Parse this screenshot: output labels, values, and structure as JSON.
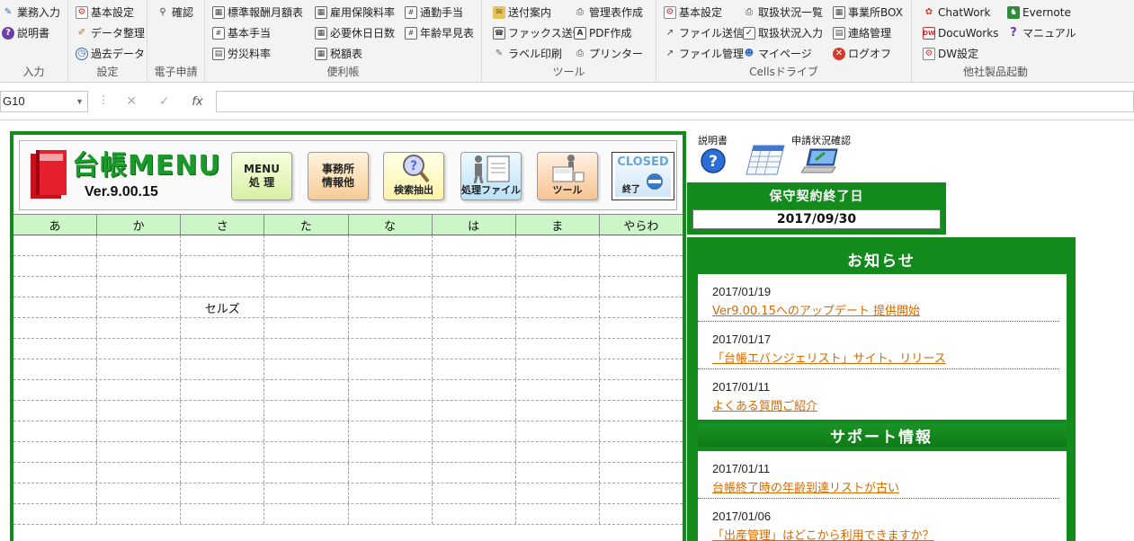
{
  "ribbon": {
    "groups": [
      {
        "label": "入力",
        "items": [
          {
            "label": "業務入力",
            "icon": "pencil-icon"
          },
          {
            "label": "説明書",
            "icon": "help-icon"
          }
        ]
      },
      {
        "label": "設定",
        "items": [
          {
            "label": "基本設定",
            "icon": "settings-icon"
          },
          {
            "label": "データ整理",
            "icon": "broom-icon"
          },
          {
            "label": "過去データ",
            "icon": "history-icon"
          }
        ]
      },
      {
        "label": "電子申請",
        "items": [
          {
            "label": "確認",
            "icon": "search-icon"
          }
        ]
      },
      {
        "label": "便利帳",
        "items": [
          {
            "label": "標準報酬月額表",
            "icon": "table-icon"
          },
          {
            "label": "基本手当",
            "icon": "calc-icon"
          },
          {
            "label": "労災料率",
            "icon": "list-icon"
          },
          {
            "label": "雇用保険料率",
            "icon": "table-icon"
          },
          {
            "label": "必要休日日数",
            "icon": "calendar-icon"
          },
          {
            "label": "税額表",
            "icon": "table-icon"
          },
          {
            "label": "通勤手当",
            "icon": "calc-icon"
          },
          {
            "label": "年齢早見表",
            "icon": "calc-icon"
          }
        ]
      },
      {
        "label": "ツール",
        "items": [
          {
            "label": "送付案内",
            "icon": "envelope-icon"
          },
          {
            "label": "ファックス送信",
            "icon": "fax-icon"
          },
          {
            "label": "ラベル印刷",
            "icon": "label-icon"
          },
          {
            "label": "管理表作成",
            "icon": "printer-icon"
          },
          {
            "label": "PDF作成",
            "icon": "pdf-icon"
          },
          {
            "label": "プリンター",
            "icon": "printer-icon"
          }
        ]
      },
      {
        "label": "Cellsドライブ",
        "items": [
          {
            "label": "基本設定",
            "icon": "settings-icon"
          },
          {
            "label": "ファイル送信",
            "icon": "upload-icon"
          },
          {
            "label": "ファイル管理",
            "icon": "folder-icon"
          },
          {
            "label": "取扱状況一覧",
            "icon": "printer-icon"
          },
          {
            "label": "取扱状況入力",
            "icon": "check-icon"
          },
          {
            "label": "マイページ",
            "icon": "users-icon"
          },
          {
            "label": "事業所BOX",
            "icon": "box-icon"
          },
          {
            "label": "連絡管理",
            "icon": "table-icon"
          },
          {
            "label": "ログオフ",
            "icon": "logoff-icon"
          }
        ]
      },
      {
        "label": "他社製品起動",
        "items": [
          {
            "label": "ChatWork",
            "icon": "chatwork-icon"
          },
          {
            "label": "DocuWorks",
            "icon": "docuworks-icon"
          },
          {
            "label": "DW設定",
            "icon": "settings-icon"
          },
          {
            "label": "Evernote",
            "icon": "evernote-icon"
          },
          {
            "label": "マニュアル",
            "icon": "question-icon"
          }
        ]
      }
    ]
  },
  "formula_bar": {
    "name_box": "G10",
    "cancel": "✕",
    "enter": "✓",
    "fx": "fx",
    "value": ""
  },
  "menu": {
    "app_title": "台帳MENU",
    "version": "Ver.9.00.15",
    "buttons": {
      "menu_line1": "MENU",
      "menu_line2": "処 理",
      "office_line1": "事務所",
      "office_line2": "情報他",
      "search": "検索抽出",
      "files": "処理ファイル",
      "tools": "ツール",
      "closed_word": "CLOSED",
      "closed_sub": "終了"
    },
    "kana": [
      "あ",
      "か",
      "さ",
      "た",
      "な",
      "は",
      "ま",
      "やらわ"
    ],
    "grid_rows": [
      [
        "",
        "",
        "",
        "",
        "",
        "",
        "",
        ""
      ],
      [
        "",
        "",
        "",
        "",
        "",
        "",
        "",
        ""
      ],
      [
        "",
        "",
        "",
        "",
        "",
        "",
        "",
        ""
      ],
      [
        "",
        "",
        "セルズ",
        "",
        "",
        "",
        "",
        ""
      ],
      [
        "",
        "",
        "",
        "",
        "",
        "",
        "",
        ""
      ],
      [
        "",
        "",
        "",
        "",
        "",
        "",
        "",
        ""
      ],
      [
        "",
        "",
        "",
        "",
        "",
        "",
        "",
        ""
      ],
      [
        "",
        "",
        "",
        "",
        "",
        "",
        "",
        ""
      ],
      [
        "",
        "",
        "",
        "",
        "",
        "",
        "",
        ""
      ],
      [
        "",
        "",
        "",
        "",
        "",
        "",
        "",
        ""
      ],
      [
        "",
        "",
        "",
        "",
        "",
        "",
        "",
        ""
      ],
      [
        "",
        "",
        "",
        "",
        "",
        "",
        "",
        ""
      ],
      [
        "",
        "",
        "",
        "",
        "",
        "",
        "",
        ""
      ],
      [
        "",
        "",
        "",
        "",
        "",
        "",
        "",
        ""
      ]
    ]
  },
  "quick_icons": {
    "manual_label": "説明書",
    "calendar_label": "",
    "status_label": "申請状況確認"
  },
  "maintenance": {
    "title": "保守契約終了日",
    "date": "2017/09/30"
  },
  "news": {
    "title": "お知らせ",
    "items": [
      {
        "date": "2017/01/19",
        "text": "Ver9.00.15へのアップデート 提供開始"
      },
      {
        "date": "2017/01/17",
        "text": "「台帳エバンジェリスト」サイト、リリース"
      },
      {
        "date": "2017/01/11",
        "text": "よくある質問ご紹介"
      }
    ]
  },
  "support": {
    "title": "サポート情報",
    "items": [
      {
        "date": "2017/01/11",
        "text": "台帳終了時の年齢到達リストが古い"
      },
      {
        "date": "2017/01/06",
        "text": "「出産管理」はどこから利用できますか？"
      }
    ]
  },
  "colors": {
    "panel_green": "#138a1c",
    "kana_bg": "#ccf5c8",
    "link_orange": "#d76a00",
    "ribbon_bg": "#f3f3f3"
  }
}
